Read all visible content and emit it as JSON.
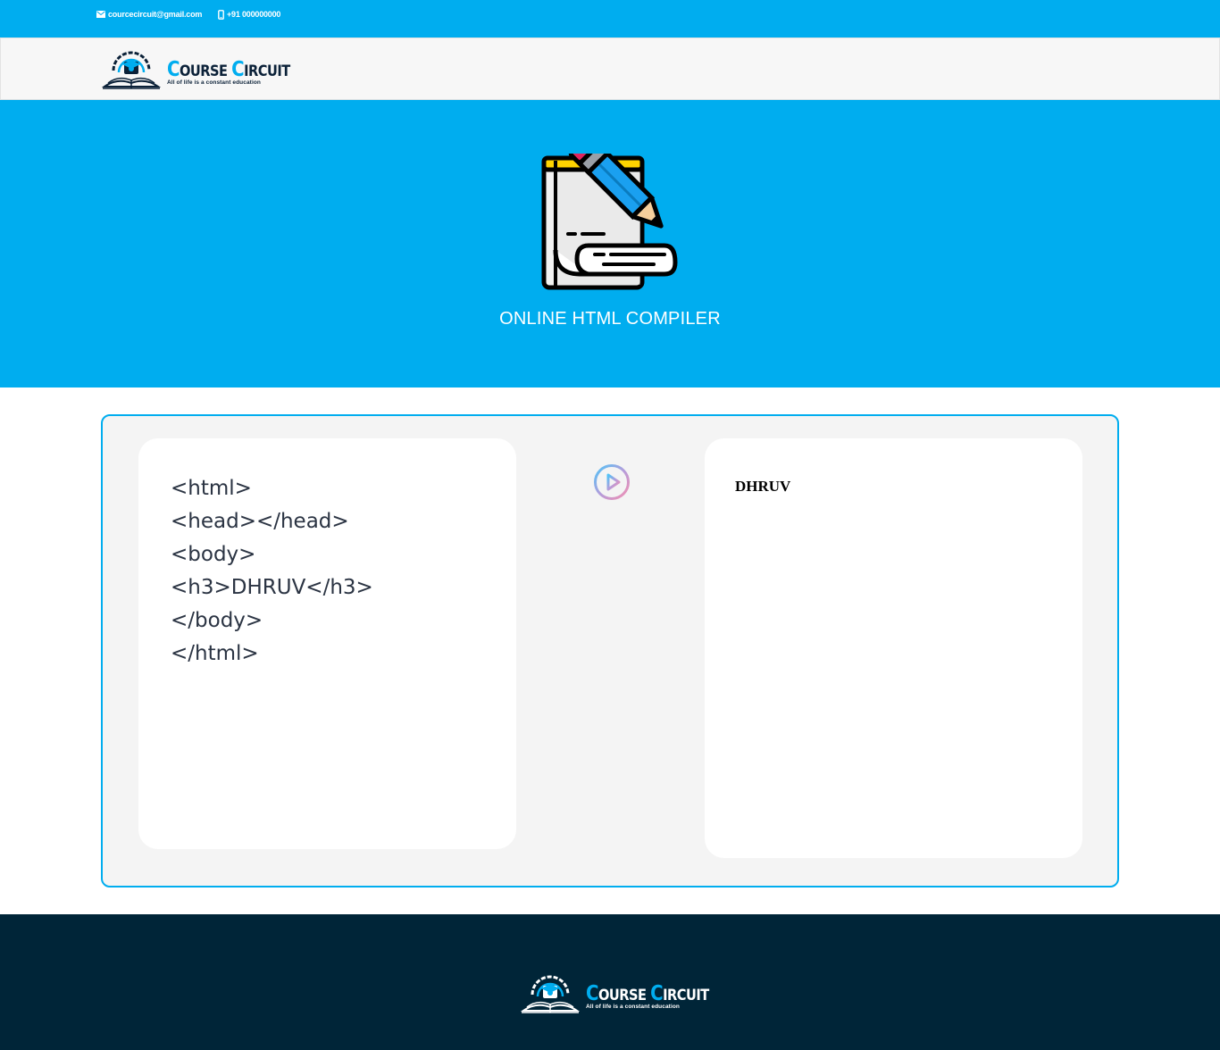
{
  "topbar": {
    "email": "courcecircuit@gmail.com",
    "phone": "+91 000000000"
  },
  "brand": {
    "name_first_cap": "C",
    "name_first_rest": "OURSE",
    "name_second_cap": "C",
    "name_second_rest": "IRCUIT",
    "tagline": "All of life is a constant education",
    "accent_color": "#00adef",
    "dark_color": "#0b2138"
  },
  "hero": {
    "title": "ONLINE HTML COMPILER",
    "icon": "notepad-pencil-icon",
    "background": "#00adef"
  },
  "editor": {
    "code": "<html>\n<head></head>\n<body>\n<h3>DHRUV</h3>\n</body>\n</html>"
  },
  "run_button": {
    "icon": "play-circle-icon"
  },
  "output": {
    "heading": "DHRUV"
  },
  "footer": {
    "background": "#002538"
  }
}
